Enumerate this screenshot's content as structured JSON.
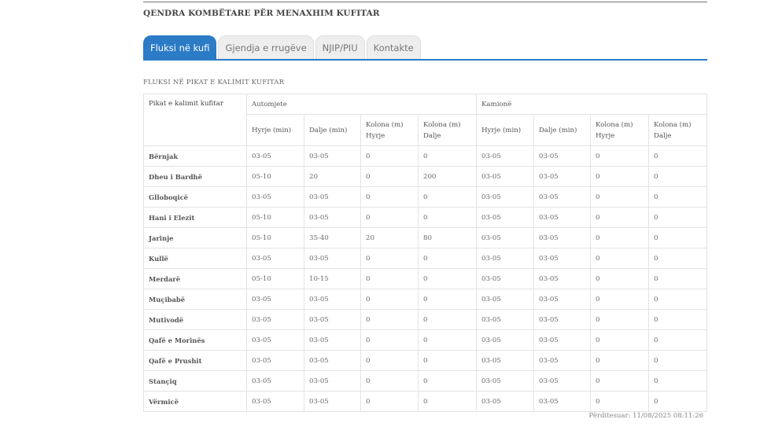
{
  "header": {
    "title": "QENDRA KOMBËTARE PËR MENAXHIM KUFITAR"
  },
  "tabs": [
    {
      "label": "Fluksi në kufi",
      "active": true
    },
    {
      "label": "Gjendja e rrugëve",
      "active": false
    },
    {
      "label": "NJIP/PIU",
      "active": false
    },
    {
      "label": "Kontakte",
      "active": false
    }
  ],
  "section": {
    "title": "FLUKSI NË PIKAT E KALIMIT KUFITAR"
  },
  "table": {
    "corner_label": "Pikat e kalimit kufitar",
    "group_cars": "Automjete",
    "group_trucks": "Kamionë",
    "columns": [
      "Hyrje (min)",
      "Dalje (min)",
      "Kolona (m) Hyrje",
      "Kolona (m) Dalje",
      "Hyrje (min)",
      "Dalje (min)",
      "Kolona (m) Hyrje",
      "Kolona (m) Dalje"
    ],
    "rows": [
      {
        "name": "Bërnjak",
        "values": [
          "03-05",
          "03-05",
          "0",
          "0",
          "03-05",
          "03-05",
          "0",
          "0"
        ]
      },
      {
        "name": "Dheu i Bardhë",
        "values": [
          "05-10",
          "20",
          "0",
          "200",
          "03-05",
          "03-05",
          "0",
          "0"
        ]
      },
      {
        "name": "Glloboqicë",
        "values": [
          "03-05",
          "03-05",
          "0",
          "0",
          "03-05",
          "03-05",
          "0",
          "0"
        ]
      },
      {
        "name": "Hani i Elezit",
        "values": [
          "05-10",
          "03-05",
          "0",
          "0",
          "03-05",
          "03-05",
          "0",
          "0"
        ]
      },
      {
        "name": "Jarinje",
        "values": [
          "05-10",
          "35-40",
          "20",
          "80",
          "03-05",
          "03-05",
          "0",
          "0"
        ]
      },
      {
        "name": "Kullë",
        "values": [
          "03-05",
          "03-05",
          "0",
          "0",
          "03-05",
          "03-05",
          "0",
          "0"
        ]
      },
      {
        "name": "Merdarë",
        "values": [
          "05-10",
          "10-15",
          "0",
          "0",
          "03-05",
          "03-05",
          "0",
          "0"
        ]
      },
      {
        "name": "Muçibabë",
        "values": [
          "03-05",
          "03-05",
          "0",
          "0",
          "03-05",
          "03-05",
          "0",
          "0"
        ]
      },
      {
        "name": "Mutivodë",
        "values": [
          "03-05",
          "03-05",
          "0",
          "0",
          "03-05",
          "03-05",
          "0",
          "0"
        ]
      },
      {
        "name": "Qafë e Morinës",
        "values": [
          "03-05",
          "03-05",
          "0",
          "0",
          "03-05",
          "03-05",
          "0",
          "0"
        ]
      },
      {
        "name": "Qafë e Prushit",
        "values": [
          "03-05",
          "03-05",
          "0",
          "0",
          "03-05",
          "03-05",
          "0",
          "0"
        ]
      },
      {
        "name": "Stançiq",
        "values": [
          "03-05",
          "03-05",
          "0",
          "0",
          "03-05",
          "03-05",
          "0",
          "0"
        ]
      },
      {
        "name": "Vërmicë",
        "values": [
          "03-05",
          "03-05",
          "0",
          "0",
          "03-05",
          "03-05",
          "0",
          "0"
        ]
      }
    ]
  },
  "footer": {
    "updated": "Përditesuar: 11/08/2025 08:11:26"
  },
  "colors": {
    "accent": "#2c7bc7",
    "tab_inactive": "#eeeeee",
    "border": "#e3e3e3"
  }
}
